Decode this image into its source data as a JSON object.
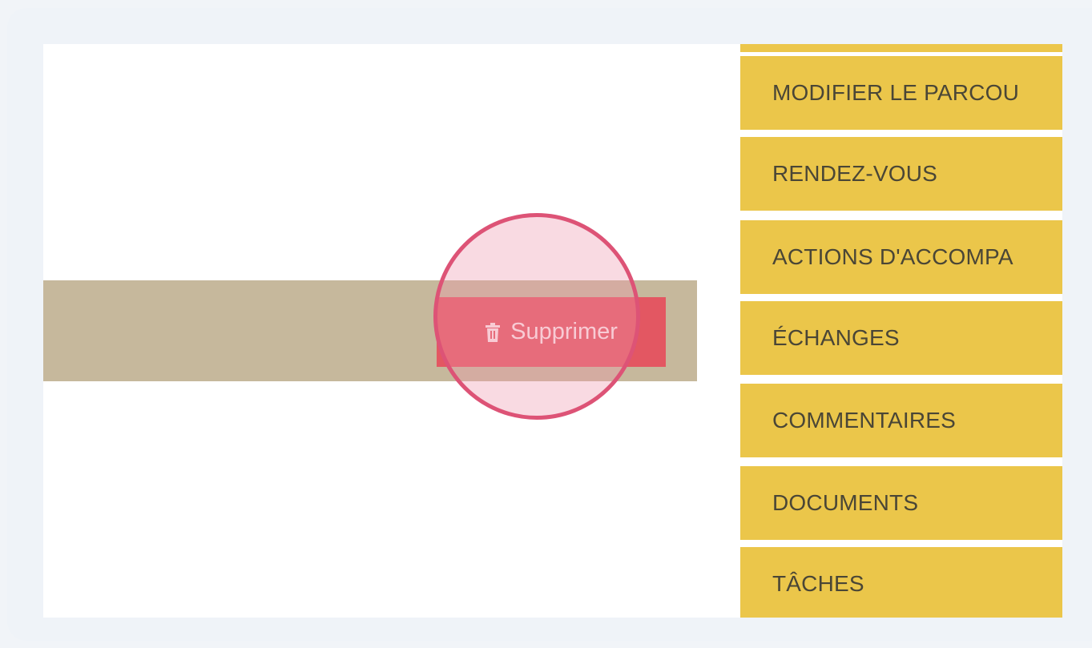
{
  "row": {
    "delete_label": "Supprimer",
    "delete_icon": "trash-icon"
  },
  "menu": {
    "items": [
      {
        "label": "MODIFIER LE PARCOU"
      },
      {
        "label": "RENDEZ-VOUS"
      },
      {
        "label": "ACTIONS D'ACCOMPA"
      },
      {
        "label": "ÉCHANGES"
      },
      {
        "label": "COMMENTAIRES"
      },
      {
        "label": "DOCUMENTS"
      },
      {
        "label": "TÂCHES"
      }
    ]
  },
  "colors": {
    "menu_background": "#ebc64a",
    "row_background": "#c6b89c",
    "delete_button": "#e35762",
    "click_highlight": "#dd5376"
  }
}
